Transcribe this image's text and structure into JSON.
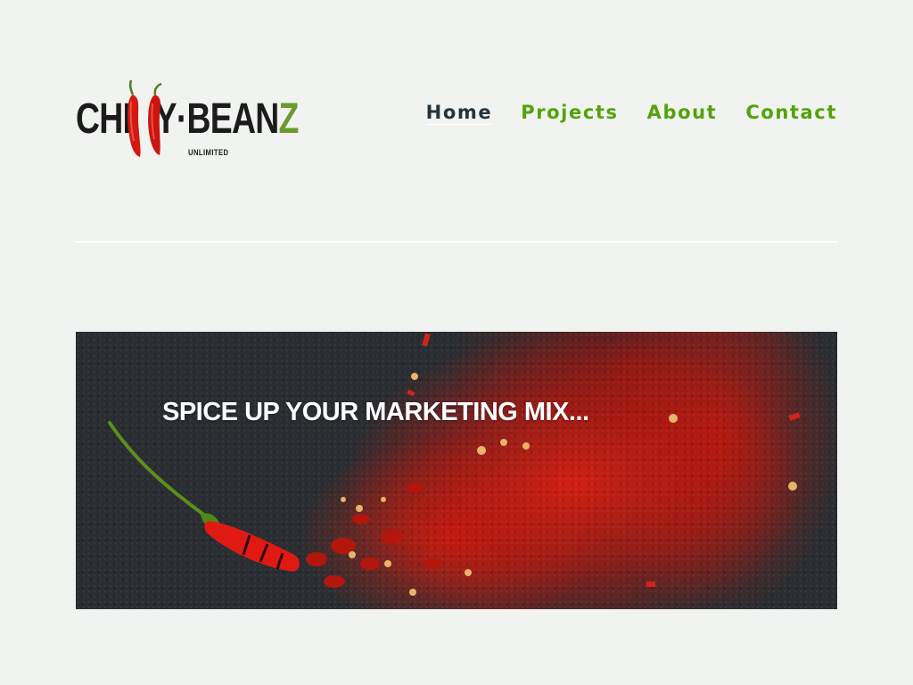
{
  "brand": {
    "logo_main_left": "CHI",
    "logo_main_right": "Y·BEAN",
    "logo_main_z": "Z",
    "logo_sub": "UNLIMITED"
  },
  "nav": {
    "items": [
      {
        "label": "Home",
        "active": true
      },
      {
        "label": "Projects",
        "active": false
      },
      {
        "label": "About",
        "active": false
      },
      {
        "label": "Contact",
        "active": false
      }
    ]
  },
  "hero": {
    "title": "SPICE UP YOUR MARKETING MIX..."
  },
  "colors": {
    "background": "#f0f3f0",
    "nav_link": "#54a20a",
    "nav_active": "#26343a",
    "logo_green": "#6a9a2e",
    "chili_red": "#d81e0f"
  },
  "icons": {
    "logo_pepper": "chili-pepper-icon"
  }
}
